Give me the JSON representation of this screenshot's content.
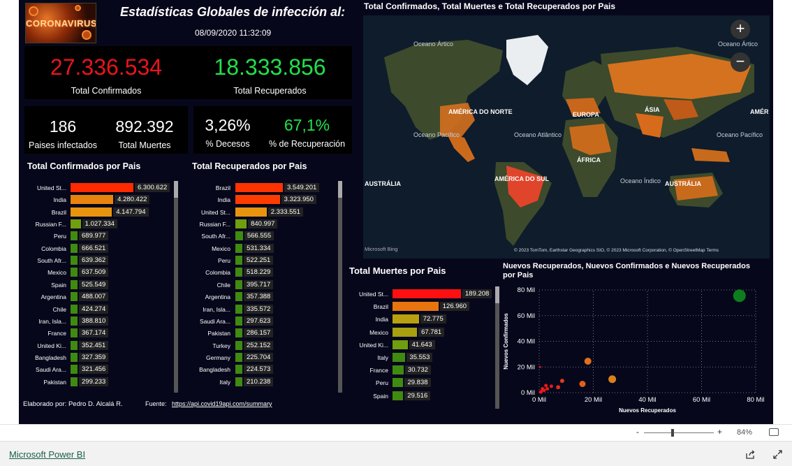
{
  "header": {
    "logo_text": "CORONAVIRUS",
    "title": "Estadísticas Globales de infección al:",
    "datetime": "08/09/2020 11:32:09"
  },
  "kpis": {
    "total_confirmados": {
      "value": "27.336.534",
      "label": "Total Confirmados",
      "color": "#e8151b"
    },
    "total_recuperados": {
      "value": "18.333.856",
      "label": "Total Recuperados",
      "color": "#22e04b"
    },
    "paises": {
      "value": "186",
      "label": "Paises infectados"
    },
    "muertes": {
      "value": "892.392",
      "label": "Total Muertes"
    },
    "decesos": {
      "value": "3,26%",
      "label": "% Decesos"
    },
    "recuperacion": {
      "value": "67,1%",
      "label": "% de Recuperación",
      "color": "#22e04b"
    }
  },
  "confirmados_chart": {
    "title": "Total Confirmados por Pais",
    "chart_data": {
      "type": "bar",
      "orientation": "horizontal",
      "categories": [
        "United St...",
        "India",
        "Brazil",
        "Russian F...",
        "Peru",
        "Colombia",
        "South Afr...",
        "Mexico",
        "Spain",
        "Argentina",
        "Chile",
        "Iran, Isla...",
        "France",
        "United Ki...",
        "Bangladesh",
        "Saudi Ara...",
        "Pakistan"
      ],
      "values": [
        6300622,
        4280422,
        4147794,
        1027334,
        689977,
        666521,
        639362,
        637509,
        525549,
        488007,
        424274,
        388810,
        367174,
        352451,
        327359,
        321456,
        299233
      ],
      "labels": [
        "6.300.622",
        "4.280.422",
        "4.147.794",
        "1.027.334",
        "689.977",
        "666.521",
        "639.362",
        "637.509",
        "525.549",
        "488.007",
        "424.274",
        "388.810",
        "367.174",
        "352.451",
        "327.359",
        "321.456",
        "299.233"
      ],
      "colors": [
        "#ff2a00",
        "#e8840e",
        "#e8940e",
        "#6f9e0f",
        "#3f8a10",
        "#3f8a10",
        "#3f8a10",
        "#3f8a10",
        "#3f8a10",
        "#3f8a10",
        "#3f8a10",
        "#3f8a10",
        "#3f8a10",
        "#3f8a10",
        "#3f8a10",
        "#3f8a10",
        "#3f8a10"
      ]
    }
  },
  "recuperados_chart": {
    "title": "Total Recuperados por Pais",
    "chart_data": {
      "type": "bar",
      "orientation": "horizontal",
      "categories": [
        "Brazil",
        "India",
        "United St...",
        "Russian F...",
        "South Afr...",
        "Mexico",
        "Peru",
        "Colombia",
        "Chile",
        "Argentina",
        "Iran, Isla...",
        "Saudi Ara...",
        "Pakistan",
        "Turkey",
        "Germany",
        "Bangladesh",
        "Italy"
      ],
      "values": [
        3549201,
        3323950,
        2333551,
        840997,
        566555,
        531334,
        522251,
        518229,
        395717,
        357388,
        335572,
        297623,
        286157,
        252152,
        225704,
        224573,
        210238
      ],
      "labels": [
        "3.549.201",
        "3.323.950",
        "2.333.551",
        "840.997",
        "566.555",
        "531.334",
        "522.251",
        "518.229",
        "395.717",
        "357.388",
        "335.572",
        "297.623",
        "286.157",
        "252.152",
        "225.704",
        "224.573",
        "210.238"
      ],
      "colors": [
        "#ff3300",
        "#ff3c00",
        "#e8940e",
        "#6f9e0f",
        "#3f8a10",
        "#3f8a10",
        "#3f8a10",
        "#3f8a10",
        "#3f8a10",
        "#3f8a10",
        "#3f8a10",
        "#3f8a10",
        "#3f8a10",
        "#3f8a10",
        "#3f8a10",
        "#3f8a10",
        "#3f8a10"
      ]
    }
  },
  "muertes_chart": {
    "title": "Total Muertes por Pais",
    "chart_data": {
      "type": "bar",
      "orientation": "horizontal",
      "categories": [
        "United St...",
        "Brazil",
        "India",
        "Mexico",
        "United Ki...",
        "Italy",
        "France",
        "Peru",
        "Spain"
      ],
      "values": [
        189208,
        126960,
        72775,
        67781,
        41643,
        35553,
        30732,
        29838,
        29516
      ],
      "labels": [
        "189.208",
        "126.960",
        "72.775",
        "67.781",
        "41.643",
        "35.553",
        "30.732",
        "29.838",
        "29.516"
      ],
      "colors": [
        "#ff1010",
        "#e8740e",
        "#b8a010",
        "#a8a010",
        "#6f9e0f",
        "#3f8a10",
        "#3f8a10",
        "#3f8a10",
        "#3f8a10"
      ]
    }
  },
  "map": {
    "title": "Total Confirmados, Total Muertes e Total Recuperados por Pais",
    "continents": [
      "AMÉRICA DO NORTE",
      "EUROPA",
      "ÁSIA",
      "ÁFRICA",
      "AMÉRICA DO SUL",
      "AUSTRÁLIA",
      "AUSTRÁLIA",
      "AMÉR"
    ],
    "oceans": [
      "Oceano Ártico",
      "Oceano Ártico",
      "Oceano Pacífico",
      "Oceano Atlântico",
      "Oceano Pacífico",
      "Oceano Índico"
    ],
    "attribution": "© 2023 TomTom, Earthstar Geographics SIO, © 2023 Microsoft Corporation, © OpenStreetMap  Terms",
    "bing_label": "Microsoft Bing",
    "zoom_in": "+",
    "zoom_out": "−"
  },
  "scatter_chart": {
    "title": "Nuevos Recuperados, Nuevos Confirmados e Nuevos Recuperados por Pais",
    "chart_data": {
      "type": "scatter",
      "xlabel": "Nuevos Recuperados",
      "ylabel": "Nuevos Confirmados",
      "xlim": [
        0,
        80000
      ],
      "ylim": [
        0,
        80000
      ],
      "xticks": [
        "0 Mil",
        "20 Mil",
        "40 Mil",
        "60 Mil",
        "80 Mil"
      ],
      "yticks": [
        "0 Mil",
        "20 Mil",
        "40 Mil",
        "60 Mil",
        "80 Mil"
      ],
      "grid": true,
      "points": [
        {
          "x": 74000,
          "y": 75500,
          "r": 9,
          "color": "#0e7d1e"
        },
        {
          "x": 18000,
          "y": 24500,
          "r": 5,
          "color": "#e0701a"
        },
        {
          "x": 27000,
          "y": 10500,
          "r": 5.5,
          "color": "#d8801a"
        },
        {
          "x": 16000,
          "y": 6800,
          "r": 4.5,
          "color": "#e0601a"
        },
        {
          "x": 8500,
          "y": 9200,
          "r": 3,
          "color": "#e03a1a"
        },
        {
          "x": 7000,
          "y": 4200,
          "r": 3,
          "color": "#e02a1a"
        },
        {
          "x": 4500,
          "y": 5000,
          "r": 2.5,
          "color": "#e0201a"
        },
        {
          "x": 3000,
          "y": 3000,
          "r": 2.5,
          "color": "#e81818"
        },
        {
          "x": 2500,
          "y": 5500,
          "r": 2.5,
          "color": "#e81818"
        },
        {
          "x": 1800,
          "y": 1800,
          "r": 2.5,
          "color": "#e81818"
        },
        {
          "x": 1200,
          "y": 3000,
          "r": 2.5,
          "color": "#e81818"
        },
        {
          "x": 800,
          "y": 1000,
          "r": 2,
          "color": "#e81818"
        },
        {
          "x": 400,
          "y": 500,
          "r": 2,
          "color": "#e81818"
        },
        {
          "x": 300,
          "y": 20000,
          "r": 1.5,
          "color": "#e81818"
        },
        {
          "x": 600,
          "y": 300,
          "r": 2,
          "color": "#e81818"
        }
      ]
    }
  },
  "footer": {
    "author": "Elaborado por: Pedro D. Alcalá R.",
    "source_label": "Fuente:",
    "source_link": "https://api.covid19api.com/summary"
  },
  "statusbar": {
    "zoom_minus": "-",
    "zoom_plus": "+",
    "zoom_level": "84%"
  },
  "bottombar": {
    "brand": "Microsoft Power BI"
  }
}
